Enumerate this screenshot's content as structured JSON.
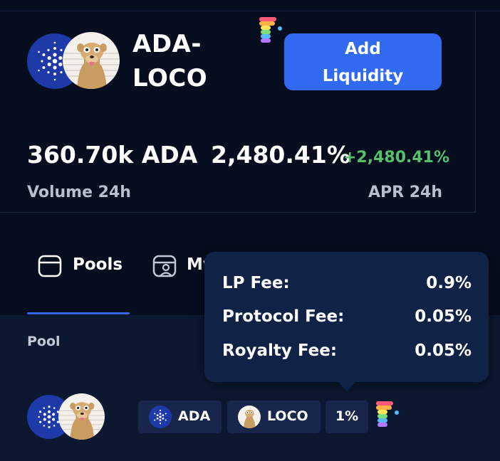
{
  "pool": {
    "pair_title": "ADA-\nLOCO",
    "token_a": "ADA",
    "token_b": "LOCO",
    "add_liquidity_label": "Add\nLiquidity"
  },
  "stats": {
    "volume_value": "360.70k ADA",
    "volume_label": "Volume 24h",
    "apr_value": "2,480.41%",
    "apr_change": "+2,480.41%",
    "apr_label": "APR 24h"
  },
  "tabs": [
    {
      "label": "Pools",
      "icon": "pools-icon",
      "active": true
    },
    {
      "label": "My",
      "icon": "my-positions-icon",
      "active": false
    }
  ],
  "table": {
    "column_pool": "Pool",
    "row": {
      "token_a_chip": "ADA",
      "token_b_chip": "LOCO",
      "fee_chip": "1%"
    }
  },
  "tooltip": {
    "rows": [
      {
        "label": "LP Fee:",
        "value": "0.9%"
      },
      {
        "label": "Protocol Fee:",
        "value": "0.05%"
      },
      {
        "label": "Royalty Fee:",
        "value": "0.05%"
      }
    ]
  },
  "colors": {
    "background": "#050d1e",
    "panel": "#0c1830",
    "accent": "#3169f0",
    "positive": "#56c16d",
    "muted_text": "#b8c0cd",
    "tooltip_bg": "#102246"
  }
}
